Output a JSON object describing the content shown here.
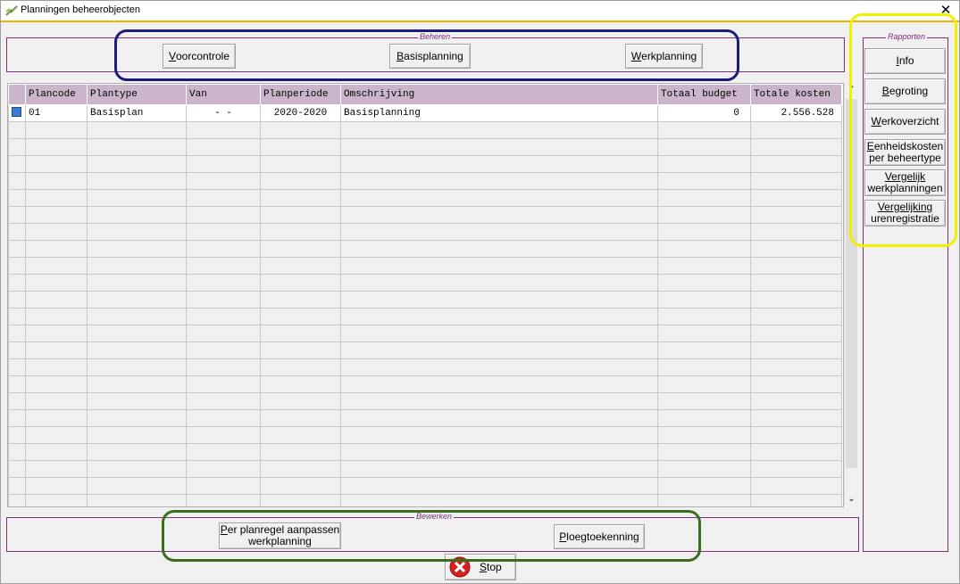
{
  "window": {
    "title": "Planningen beheerobjecten"
  },
  "beheren": {
    "label": "Beheren",
    "voorcontrole": {
      "hot": "V",
      "rest": "oorcontrole"
    },
    "basisplanning": {
      "hot": "B",
      "rest": "asisplanning"
    },
    "werkplanning": {
      "hot": "W",
      "rest": "erkplanning"
    }
  },
  "table": {
    "columns": [
      "Plancode",
      "Plantype",
      "Van",
      "Planperiode",
      "Omschrijving",
      "Totaal budget",
      "Totale kosten"
    ],
    "rows": [
      {
        "plancode": "01",
        "plantype": "Basisplan",
        "van": "-   -",
        "planperiode": "2020-2020",
        "omschrijving": "Basisplanning",
        "totaal_budget": "0",
        "totale_kosten": "2.556.528"
      }
    ]
  },
  "rapporten": {
    "label": "Rapporten",
    "info": {
      "hot": "I",
      "rest": "nfo"
    },
    "begroting": {
      "hot": "B",
      "rest": "egroting"
    },
    "werkoverzicht": {
      "hot": "W",
      "rest": "erkoverzicht"
    },
    "eenheidskosten": {
      "hot": "E",
      "rest": "enheidskosten",
      "line2": "per beheertype"
    },
    "vergelijk": {
      "hot": "V",
      "rest": "ergelijk",
      "line2": "werkplanningen"
    },
    "vergelijking": {
      "hot": "V",
      "rest": "ergelijking",
      "line2": "urenregistratie"
    }
  },
  "bewerken": {
    "label": "Bewerken",
    "per_planregel": {
      "hot": "P",
      "rest": "er planregel aanpassen",
      "line2": "werkplanning"
    },
    "ploegtoekenning": {
      "hot": "P",
      "rest": "loegtoekenning"
    }
  },
  "stop": {
    "hot": "S",
    "rest": "top"
  },
  "colors": {
    "accent": "#f0b400",
    "group_border": "#7c2d7c",
    "header_bg": "#cbb5cb",
    "hl_blue": "#1c1c7c",
    "hl_green": "#3c6c1c",
    "hl_yellow": "#f0f000"
  }
}
